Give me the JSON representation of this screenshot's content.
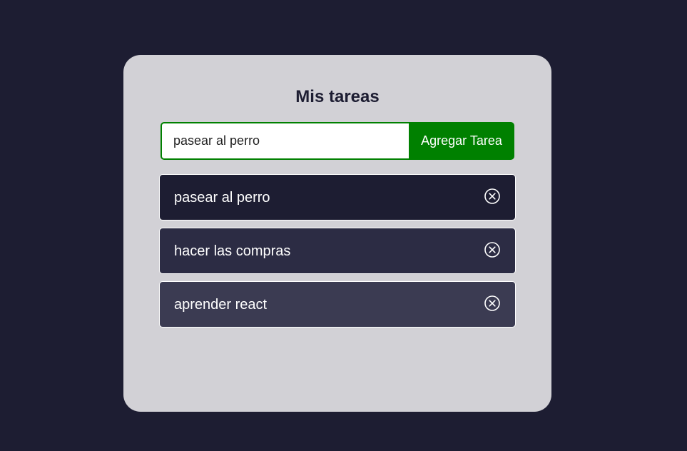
{
  "app": {
    "title": "Mis tareas"
  },
  "form": {
    "input_value": "pasear al perro",
    "add_button_label": "Agregar Tarea"
  },
  "tasks": [
    {
      "text": "pasear al perro",
      "delete_icon": "circle-x-icon"
    },
    {
      "text": "hacer las compras",
      "delete_icon": "circle-x-icon"
    },
    {
      "text": "aprender react",
      "delete_icon": "circle-x-icon"
    }
  ],
  "colors": {
    "page_background": "#1d1d32",
    "card_background": "#d2d1d6",
    "accent_green": "#008000",
    "task_1": "#1d1d32",
    "task_2": "#2c2c44",
    "task_3": "#3b3b52"
  }
}
